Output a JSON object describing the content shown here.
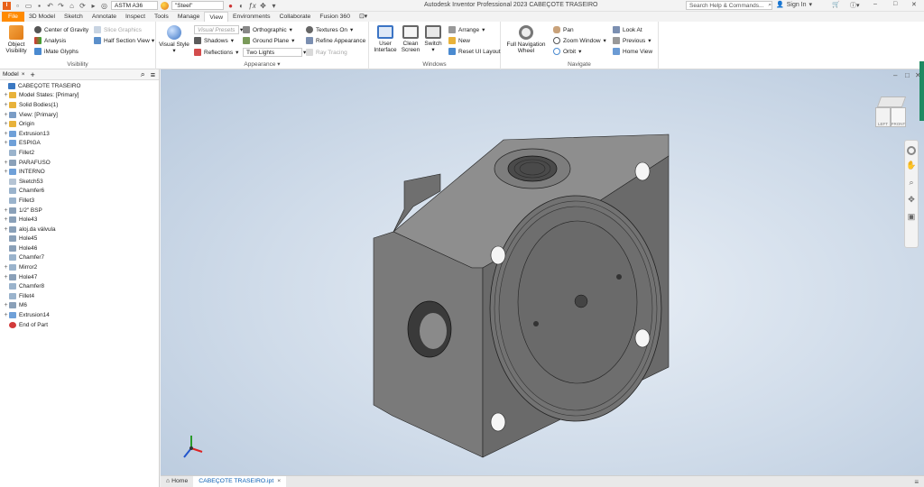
{
  "quick_access": {
    "material": "ASTM A36",
    "appearance": "\"Steel\""
  },
  "app_title": "Autodesk Inventor Professional 2023   CABEÇOTE TRASEIRO",
  "search": {
    "placeholder": "Search Help & Commands..."
  },
  "user": {
    "sign_in": "Sign In"
  },
  "ribbon_tabs": [
    "File",
    "3D Model",
    "Sketch",
    "Annotate",
    "Inspect",
    "Tools",
    "Manage",
    "View",
    "Environments",
    "Collaborate",
    "Fusion 360"
  ],
  "active_tab": "View",
  "ribbon": {
    "visibility": {
      "label": "Visibility",
      "object_visibility": "Object\nVisibility",
      "center_of_gravity": "Center of Gravity",
      "analysis": "Analysis",
      "imate_glyphs": "iMate Glyphs",
      "slice_graphics": "Slice Graphics",
      "half_section_view": "Half Section View"
    },
    "appearance": {
      "label": "Appearance",
      "visual_style": "Visual Style",
      "visual_presets": "Visual Presets",
      "shadows": "Shadows",
      "reflections": "Reflections",
      "orthographic": "Orthographic",
      "ground_plane": "Ground Plane",
      "lights": "Two Lights",
      "textures_on": "Textures On",
      "refine_appearance": "Refine Appearance",
      "ray_tracing": "Ray Tracing"
    },
    "windows": {
      "label": "Windows",
      "user_interface": "User\nInterface",
      "clean_screen": "Clean\nScreen",
      "switch": "Switch",
      "arrange": "Arrange",
      "new": "New",
      "reset_ui_layout": "Reset UI Layout"
    },
    "navigate": {
      "label": "Navigate",
      "full_nav_wheel": "Full Navigation\nWheel",
      "pan": "Pan",
      "zoom_window": "Zoom Window",
      "orbit": "Orbit",
      "look_at": "Look At",
      "previous": "Previous",
      "home_view": "Home View"
    }
  },
  "browser": {
    "tab": "Model",
    "items": [
      {
        "label": "CABEÇOTE TRASEIRO",
        "level": 0,
        "expand": "",
        "icon": "#3a78c2"
      },
      {
        "label": "Model States: [Primary]",
        "level": 1,
        "expand": "+",
        "icon": "#e8b23a"
      },
      {
        "label": "Solid Bodies(1)",
        "level": 1,
        "expand": "+",
        "icon": "#e8b23a"
      },
      {
        "label": "View: [Primary]",
        "level": 1,
        "expand": "+",
        "icon": "#7a9cc6"
      },
      {
        "label": "Origin",
        "level": 1,
        "expand": "+",
        "icon": "#e8b23a"
      },
      {
        "label": "Extrusion13",
        "level": 1,
        "expand": "+",
        "icon": "#6fa0d8"
      },
      {
        "label": "ESPIGA",
        "level": 1,
        "expand": "+",
        "icon": "#6fa0d8"
      },
      {
        "label": "Fillet2",
        "level": 1,
        "expand": "",
        "icon": "#9ab3cc"
      },
      {
        "label": "PARAFUSO",
        "level": 1,
        "expand": "+",
        "icon": "#8aa0b8"
      },
      {
        "label": "INTERNO",
        "level": 1,
        "expand": "+",
        "icon": "#6fa0d8"
      },
      {
        "label": "Sketch53",
        "level": 1,
        "expand": "",
        "icon": "#b5c4d4"
      },
      {
        "label": "Chamfer6",
        "level": 1,
        "expand": "",
        "icon": "#9ab3cc"
      },
      {
        "label": "Fillet3",
        "level": 1,
        "expand": "",
        "icon": "#9ab3cc"
      },
      {
        "label": "1/2\" BSP",
        "level": 1,
        "expand": "+",
        "icon": "#8aa0b8"
      },
      {
        "label": "Hole43",
        "level": 1,
        "expand": "+",
        "icon": "#8aa0b8"
      },
      {
        "label": "aloj.da válvula",
        "level": 1,
        "expand": "+",
        "icon": "#8aa0b8"
      },
      {
        "label": "Hole45",
        "level": 1,
        "expand": "",
        "icon": "#8aa0b8"
      },
      {
        "label": "Hole46",
        "level": 1,
        "expand": "",
        "icon": "#8aa0b8"
      },
      {
        "label": "Chamfer7",
        "level": 1,
        "expand": "",
        "icon": "#9ab3cc"
      },
      {
        "label": "Mirror2",
        "level": 1,
        "expand": "+",
        "icon": "#9ab3cc"
      },
      {
        "label": "Hole47",
        "level": 1,
        "expand": "+",
        "icon": "#8aa0b8"
      },
      {
        "label": "Chamfer8",
        "level": 1,
        "expand": "",
        "icon": "#9ab3cc"
      },
      {
        "label": "Fillet4",
        "level": 1,
        "expand": "",
        "icon": "#9ab3cc"
      },
      {
        "label": "M6",
        "level": 1,
        "expand": "+",
        "icon": "#8aa0b8"
      },
      {
        "label": "Extrusion14",
        "level": 1,
        "expand": "+",
        "icon": "#6fa0d8"
      },
      {
        "label": "End of Part",
        "level": 1,
        "expand": "",
        "icon": "#d23a3a"
      }
    ]
  },
  "viewcube": {
    "left": "LEFT",
    "front": "FRONT"
  },
  "doc_tabs": {
    "home": "Home",
    "document": "CABEÇOTE TRASEIRO.ipt"
  },
  "colors": {
    "file_tab": "#ff8a00",
    "part_dark": "#5c5c5c",
    "part_mid": "#808080",
    "part_light": "#9a9a9a",
    "viewport_bg": "#cfdbe9"
  }
}
